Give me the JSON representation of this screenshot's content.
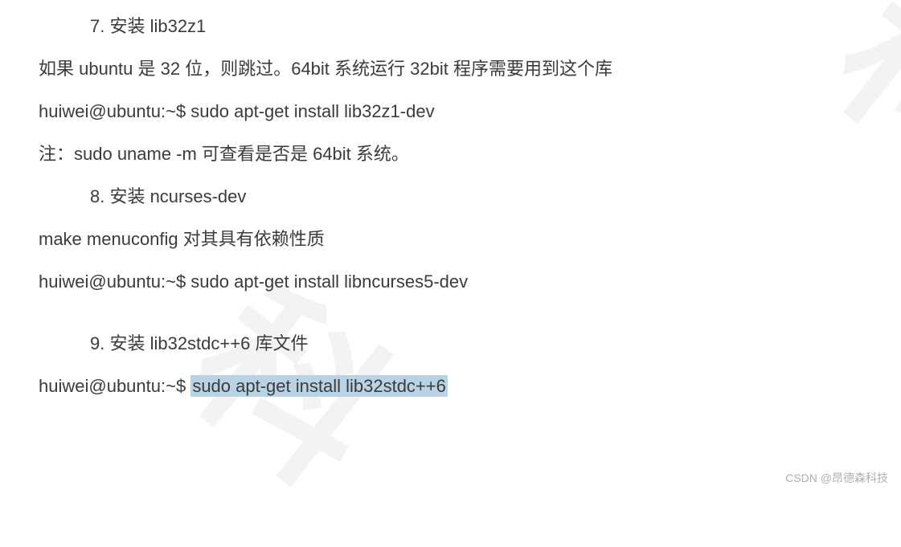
{
  "watermark_big": "科",
  "lines": {
    "s7_heading": "7.   安装 lib32z1",
    "s7_body1": "如果 ubuntu 是 32 位，则跳过。64bit  系统运行 32bit 程序需要用到这个库",
    "s7_cmd": "huiwei@ubuntu:~$ sudo apt-get install lib32z1-dev",
    "s7_note": "注：sudo uname -m  可查看是否是 64bit 系统。",
    "s8_heading": "8.   安装  ncurses-dev",
    "s8_body1": "make menuconfig  对其具有依赖性质",
    "s8_cmd": "huiwei@ubuntu:~$ sudo apt-get install libncurses5-dev",
    "s9_heading": "9.  安装 lib32stdc++6 库文件",
    "s9_prompt": "huiwei@ubuntu:~$ ",
    "s9_cmd_highlighted": "sudo apt-get install lib32stdc++6"
  },
  "bottom_watermark": "CSDN @昂德森科技"
}
